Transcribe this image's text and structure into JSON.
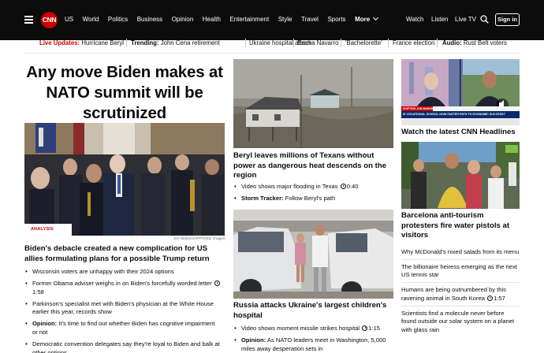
{
  "nav": {
    "logo": "CNN",
    "links": [
      "US",
      "World",
      "Politics",
      "Business",
      "Opinion",
      "Health",
      "Entertainment",
      "Style",
      "Travel",
      "Sports"
    ],
    "more": "More",
    "watch": "Watch",
    "listen": "Listen",
    "live_tv": "Live TV",
    "sign_in": "Sign in"
  },
  "trending": {
    "live_label": "Live Updates:",
    "live_item": "Hurricane Beryl",
    "trending_label": "Trending:",
    "items": [
      "John Cena retirement",
      "Ukraine hospital attack",
      "Emma Navarro",
      "'Bachelorette'",
      "France election"
    ],
    "audio_label": "Audio:",
    "audio_item": "Rust Belt voters"
  },
  "lead": {
    "headline": "Any move Biden makes at NATO summit will be scrutinized",
    "badge": "ANALYSIS",
    "credit": "Jim Watson/AFP/Getty Images",
    "title": "Biden's debacle created a new complication for US allies formulating plans for a possible Trump return",
    "bullets": [
      {
        "prefix": "",
        "text": "Wisconsin voters are unhappy with their 2024 options",
        "time": ""
      },
      {
        "prefix": "",
        "text": "Former Obama adviser weighs in on Biden's forcefully worded letter",
        "time": "1:58"
      },
      {
        "prefix": "",
        "text": "Parkinson's specialist met with Biden's physician at the White House earlier this year, records show",
        "time": ""
      },
      {
        "prefix": "Opinion:",
        "text": "It's time to find out whether Biden has cognitive impairment or not",
        "time": ""
      },
      {
        "prefix": "",
        "text": "Democratic convention delegates say they're loyal to Biden and balk at other options",
        "time": ""
      }
    ]
  },
  "middle": {
    "story1": {
      "title": "Beryl leaves millions of Texans without power as dangerous heat descends on the region",
      "bullets": [
        {
          "prefix": "",
          "text": "Video shows major flooding in Texas",
          "time": "0:40"
        },
        {
          "prefix": "Storm Tracker:",
          "text": "Follow Beryl's path",
          "time": ""
        }
      ]
    },
    "story2": {
      "title": "Russia attacks Ukraine's largest children's hospital",
      "bullets": [
        {
          "prefix": "",
          "text": "Video shows moment missile strikes hospital",
          "time": "1:15"
        },
        {
          "prefix": "Opinion:",
          "text": "As NATO leaders meet in Washington, 5,000 miles away desperation sets in",
          "time": ""
        }
      ]
    }
  },
  "right": {
    "video_title": "Watch the latest CNN Headlines",
    "ticker_tag": "SHIFTING JOB MARKET",
    "ticker_text": "IS VOCATIONAL SCHOOL NOW FASTER PATH TO ECONOMIC SUCCESS?",
    "story_title": "Barcelona anti-tourism protesters fire water pistols at visitors",
    "list": [
      {
        "text": "Why McDonald's nixed salads from its menu",
        "time": ""
      },
      {
        "text": "The billionaire heiress emerging as the next US tennis star",
        "time": ""
      },
      {
        "text": "Humans are being outnumbered by this ravening animal in South Korea",
        "time": "1:57"
      },
      {
        "text": "Scientists find a molecule never before found outside our solar system on a planet with glass rain",
        "time": ""
      }
    ]
  },
  "colors": {
    "brand_red": "#cc0000",
    "nav_bg": "#0c0c0c"
  }
}
